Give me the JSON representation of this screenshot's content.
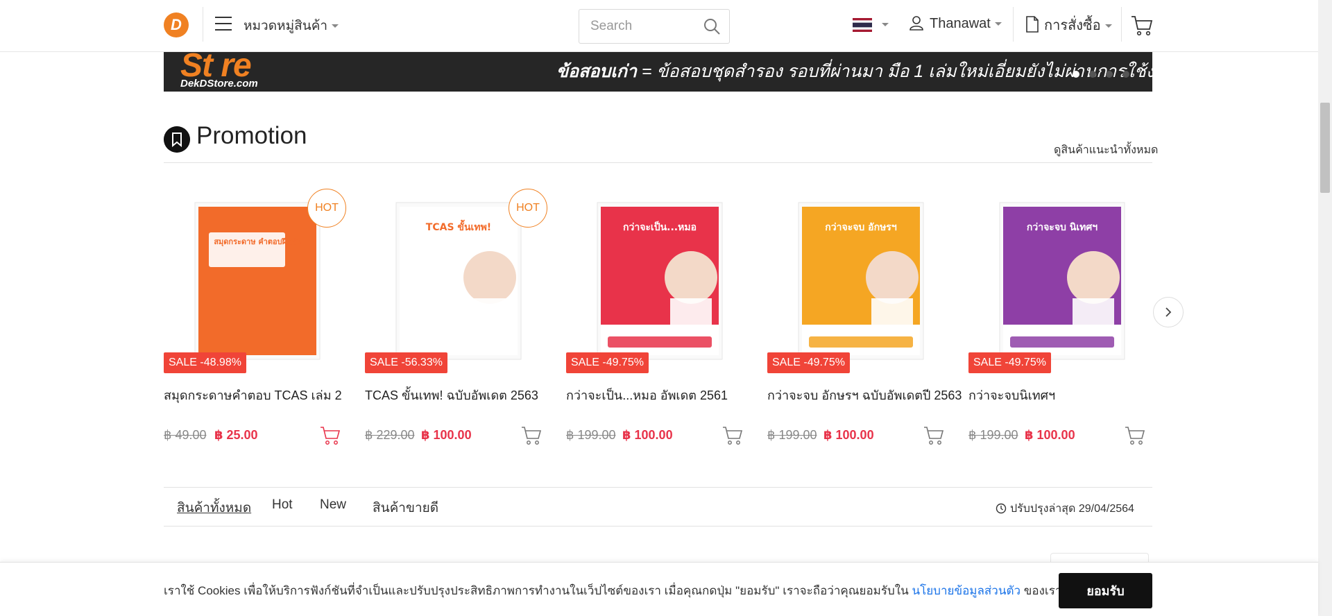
{
  "header": {
    "logo_letter": "D",
    "category_menu": "หมวดหมู่สินค้า",
    "search_placeholder": "Search",
    "user_name": "Thanawat",
    "orders_label": "การสั่งซื้อ"
  },
  "banner": {
    "logo_text": "St re",
    "domain": "DekDStore.com",
    "bold_text": "ข้อสอบเก่า",
    "text": " = ข้อสอบชุดสำรอง รอบที่ผ่านมา มือ 1 เล่มใหม่เอี่ยมยังไม่ผ่านการใช้งาน"
  },
  "promotion": {
    "title": "Promotion",
    "view_all": "ดูสินค้าแนะนำทั้งหมด"
  },
  "products": [
    {
      "hot": "HOT",
      "sale": "SALE -48.98%",
      "name": "สมุดกระดาษคำตอบ TCAS เล่ม 2",
      "old_price": "฿ 49.00",
      "new_price": "฿ 25.00",
      "cover_title": "สมุดกระดาษ คำตอบฝึกฝน",
      "cover_color": "#f26b2a"
    },
    {
      "hot": "HOT",
      "sale": "SALE -56.33%",
      "name": "TCAS ขั้นเทพ! ฉบับอัพเดต 2563",
      "old_price": "฿ 229.00",
      "new_price": "฿ 100.00",
      "cover_title": "TCAS ขั้นเทพ!",
      "cover_color": "#ffffff"
    },
    {
      "hot": "",
      "sale": "SALE -49.75%",
      "name": "กว่าจะเป็น...หมอ อัพเดต 2561",
      "old_price": "฿ 199.00",
      "new_price": "฿ 100.00",
      "cover_title": "กว่าจะเป็น...หมอ",
      "cover_color": "#e8334a"
    },
    {
      "hot": "",
      "sale": "SALE -49.75%",
      "name": "กว่าจะจบ อักษรฯ ฉบับอัพเดตปี 2563",
      "old_price": "฿ 199.00",
      "new_price": "฿ 100.00",
      "cover_title": "กว่าจะจบ อักษรฯ",
      "cover_color": "#f5a623"
    },
    {
      "hot": "",
      "sale": "SALE -49.75%",
      "name": "กว่าจะจบนิเทศฯ",
      "old_price": "฿ 199.00",
      "new_price": "฿ 100.00",
      "cover_title": "กว่าจะจบ นิเทศฯ",
      "cover_color": "#8e3fa6"
    }
  ],
  "tabs": [
    "สินค้าทั้งหมด",
    "Hot",
    "New",
    "สินค้าขายดี"
  ],
  "updated": "ปรับปรุงล่าสุด 29/04/2564",
  "cookie": {
    "text": "เราใช้ Cookies เพื่อให้บริการฟังก์ชันที่จำเป็นและปรับปรุงประสิทธิภาพการทำงานในเว็ปไซต์ของเรา เมื่อคุณกดปุ่ม \"ยอมรับ\" เราจะถือว่าคุณยอมรับใน ",
    "link": "นโยบายข้อมูลส่วนตัว",
    "suffix": " ของเรา",
    "accept": "ยอมรับ"
  },
  "colors": {
    "brand": "#f08122",
    "sale": "#f04438",
    "price": "#e8334a",
    "link": "#1a73e8"
  }
}
